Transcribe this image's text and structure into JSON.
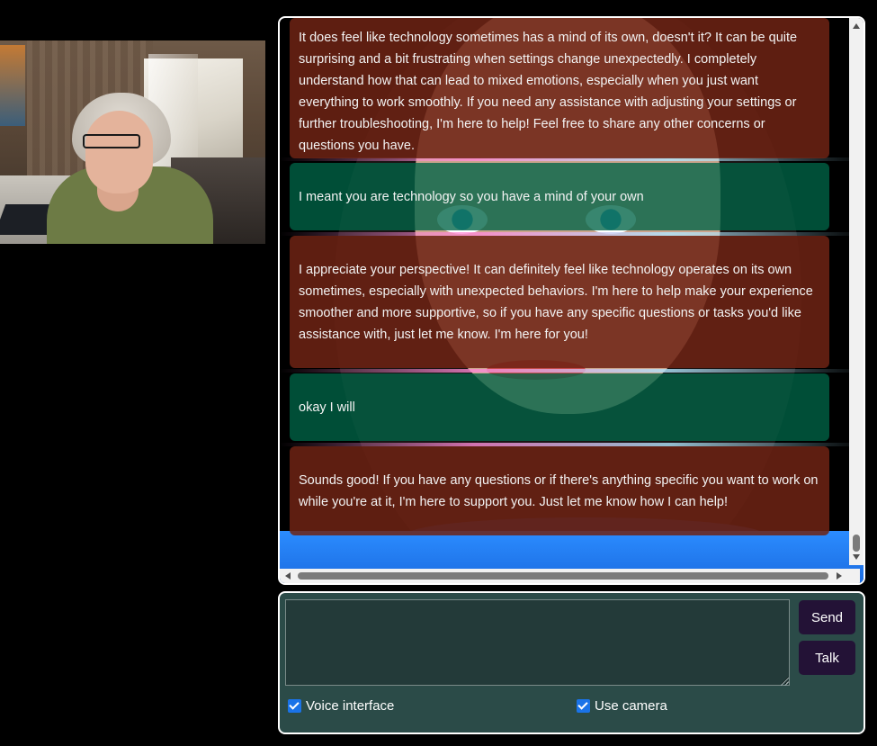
{
  "chat": {
    "messages": [
      {
        "role": "ai",
        "text": "It does feel like technology sometimes has a mind of its own, doesn't it? It can be quite surprising and a bit frustrating when settings change unexpectedly. I completely understand how that can lead to mixed emotions, especially when you just want everything to work smoothly. If you need any assistance with adjusting your settings or further troubleshooting, I'm here to help! Feel free to share any other concerns or questions you have."
      },
      {
        "role": "user",
        "text": "I meant you are technology so you have a mind of your own"
      },
      {
        "role": "ai",
        "text": "I appreciate your perspective! It can definitely feel like technology operates on its own sometimes, especially with unexpected behaviors. I'm here to help make your experience smoother and more supportive, so if you have any specific questions or tasks you'd like assistance with, just let me know. I'm here for you!"
      },
      {
        "role": "user",
        "text": "okay I will"
      },
      {
        "role": "ai",
        "text": "Sounds good! If you have any questions or if there's anything specific you want to work on while you're at it, I'm here to support you. Just let me know how I can help!"
      }
    ]
  },
  "composer": {
    "input_value": "",
    "send_label": "Send",
    "talk_label": "Talk",
    "voice_label": "Voice interface",
    "voice_checked": true,
    "camera_label": "Use camera",
    "camera_checked": true
  },
  "colors": {
    "ai_bubble": "#6e2314",
    "user_bubble": "#006446",
    "button_bg": "#231236",
    "panel_bg": "#2b4b48",
    "checkbox": "#1a73e8"
  }
}
